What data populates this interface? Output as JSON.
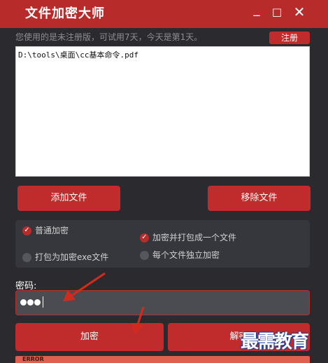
{
  "window": {
    "title": "文件加密大师",
    "minimize_label": "_",
    "maximize_label": "□",
    "close_label": "✕"
  },
  "notice": {
    "text": "您使用的是未注册版，可试用7天，今天是第1天。",
    "register_label": "注册"
  },
  "file_list": {
    "items": [
      "D:\\tools\\桌面\\cc基本命令.pdf"
    ]
  },
  "file_buttons": {
    "add_label": "添加文件",
    "remove_label": "移除文件"
  },
  "options": {
    "normal_label": "普通加密",
    "exe_label": "打包为加密exe文件",
    "pack_label": "加密并打包成一个文件",
    "independent_label": "每个文件独立加密",
    "normal_checked": true,
    "pack_checked": true
  },
  "password": {
    "label": "密码:",
    "masked_length": 3
  },
  "actions": {
    "encrypt_label": "加密",
    "decrypt_label": "解密"
  },
  "status": {
    "text": "ERROR"
  },
  "watermark": {
    "text": "最需教育"
  },
  "colors": {
    "accent_red": "#c02b2b",
    "titlebar_red": "#b82b2b",
    "background": "#2b2b2f",
    "annotation_arrow": "#d42a1e"
  }
}
